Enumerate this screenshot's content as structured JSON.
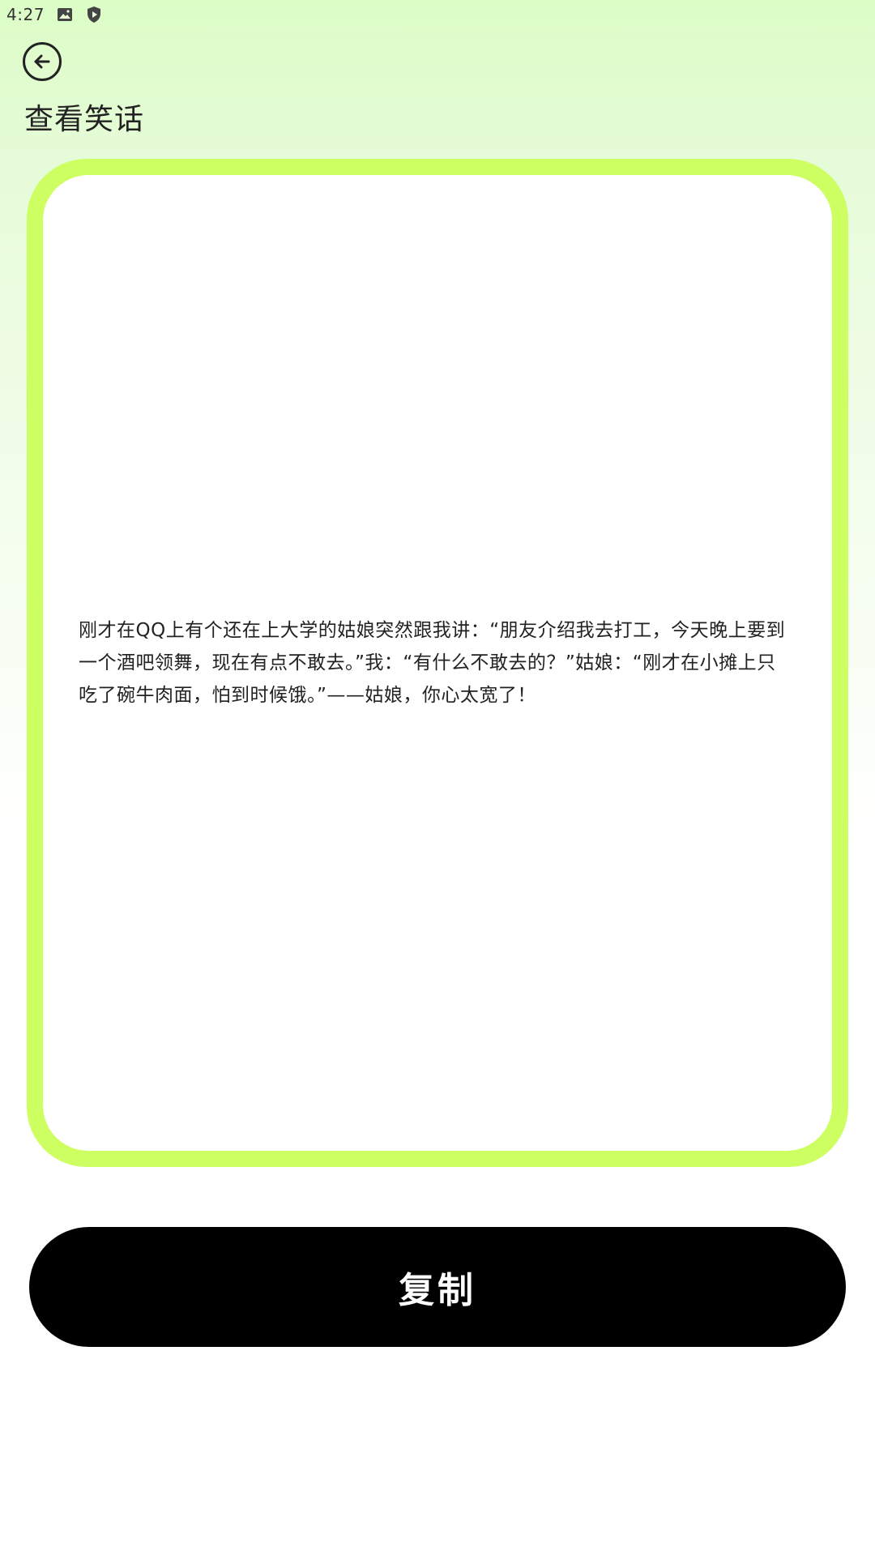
{
  "status_bar": {
    "time": "4:27",
    "icons": [
      "image-icon",
      "shield-play-icon"
    ]
  },
  "header": {
    "back_icon": "arrow-left-circle-icon",
    "title": "查看笑话"
  },
  "joke": {
    "text": "刚才在QQ上有个还在上大学的姑娘突然跟我讲：“朋友介绍我去打工，今天晚上要到\n一个酒吧领舞，现在有点不敢去。”我：“有什么不敢去的？”姑娘：“刚才在小摊上只\n吃了碗牛肉面，怕到时候饿。”——姑娘，你心太宽了！"
  },
  "actions": {
    "copy_label": "复制"
  },
  "colors": {
    "card_border": "#cdff63",
    "button_bg": "#000000",
    "button_text": "#ffffff",
    "bg_top": "#dcfdc6"
  }
}
